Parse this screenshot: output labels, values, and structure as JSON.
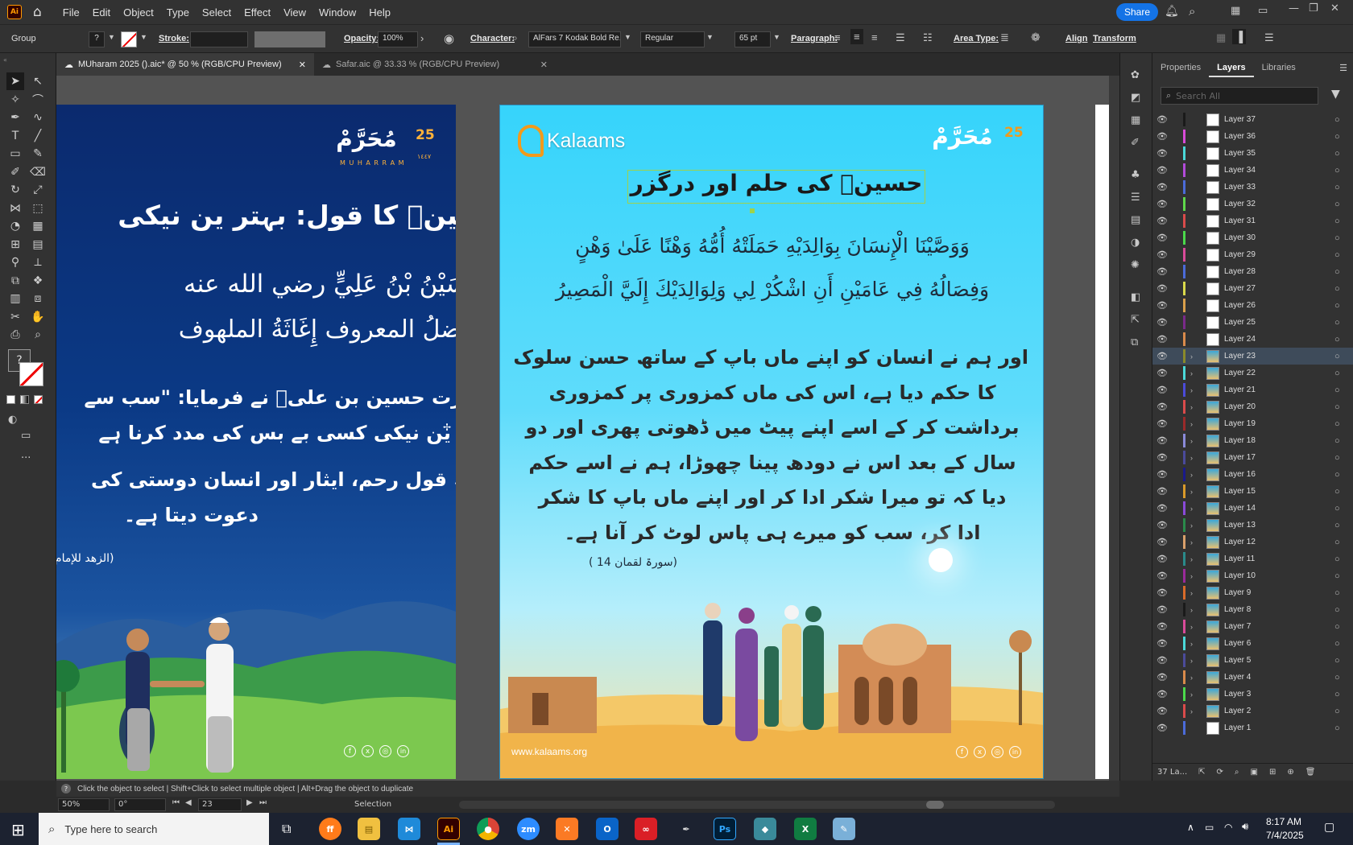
{
  "menubar": {
    "app_logo": "Ai",
    "items": [
      "File",
      "Edit",
      "Object",
      "Type",
      "Select",
      "Effect",
      "View",
      "Window",
      "Help"
    ],
    "share_label": "Share"
  },
  "control_bar": {
    "group_label": "Group",
    "stroke_label": "Stroke:",
    "opacity_label": "Opacity:",
    "opacity_value": "100%",
    "character_label": "Character:",
    "font_family": "AlFars 7 Kodak Bold Re...",
    "font_style": "Regular",
    "font_size": "65 pt",
    "paragraph_label": "Paragraph:",
    "area_type_label": "Area Type:",
    "align_label": "Align",
    "transform_label": "Transform"
  },
  "tabs": [
    {
      "label": "MUharam 2025 ().aic* @ 50 % (RGB/CPU Preview)",
      "active": true
    },
    {
      "label": "Safar.aic @ 33.33 % (RGB/CPU Preview)",
      "active": false
    }
  ],
  "artboard_left": {
    "logo_text": "مُحَرَّمْ",
    "logo_number": "25",
    "logo_sub": "M U H A R R A M",
    "logo_year": "١٤٤٧",
    "title": "حسینؓ کا قول: بہتر ین نیکی",
    "arabic_line1": "قَالَ الْحُسَيْنُ بْنُ عَلِيٍّ رضي الله عنه",
    "arabic_line2": "أَفضلُ المعروف إِغَاثَةُ الملهوف",
    "urdu_line1": "حضرت حسین بن علیؓ نے فرمایا: \"سب سے",
    "urdu_line2": "بہتر ین نیکی کسی بے بس کی مدد کرنا ہے",
    "faida_line1": "فائدہ: یہ قول رحم، ایثار اور انسان دوستی کی",
    "faida_line2": "دعوت دیتا ہے۔",
    "source": "(الزهد للإمام أحمد)"
  },
  "artboard_right": {
    "brand": "Kalaams",
    "logo_text": "مُحَرَّمْ",
    "logo_number": "25",
    "title": "حسینؓ کی حلم اور درگزر",
    "ayah_line1": "وَوَصَّيْنَا الْإِنسَانَ بِوَالِدَيْهِ حَمَلَتْهُ أُمُّهُ وَهْنًا عَلَىٰ وَهْنٍ",
    "ayah_line2": "وَفِصَالُهُ فِي عَامَيْنِ أَنِ اشْكُرْ لِي وَلِوَالِدَيْكَ إِلَيَّ الْمَصِيرُ",
    "urdu_lines": [
      "اور ہم نے انسان کو اپنے ماں باپ کے ساتھ حسن سلوک",
      "کا حکم دیا ہے، اس کی ماں کمزوری پر کمزوری",
      "برداشت کر کے اسے اپنے پیٹ میں ڈھوتی پھری اور دو",
      "سال کے بعد اس نے دودھ پینا چھوڑا، ہم نے اسے حکم",
      "دیا کہ تو میرا شکر ادا کر اور اپنے ماں باپ کا شکر",
      "ادا کر، سب کو میرے ہی پاس لوٹ کر آنا ہے۔"
    ],
    "reference": "(سورۃ لقمان 14 )",
    "website": "www.kalaams.org",
    "social": [
      "f",
      "x",
      "◎",
      "in"
    ]
  },
  "right_panel": {
    "tabs": [
      "Properties",
      "Layers",
      "Libraries"
    ],
    "active_tab": "Layers",
    "search_placeholder": "Search All",
    "layers": [
      {
        "name": "Layer 37",
        "color": "#1a1a1a",
        "thumb": "white"
      },
      {
        "name": "Layer 36",
        "color": "#d94bd9",
        "thumb": "white"
      },
      {
        "name": "Layer 35",
        "color": "#4ad9d9",
        "thumb": "white"
      },
      {
        "name": "Layer 34",
        "color": "#b24bd9",
        "thumb": "white"
      },
      {
        "name": "Layer 33",
        "color": "#4b6bd9",
        "thumb": "white"
      },
      {
        "name": "Layer 32",
        "color": "#5fd94b",
        "thumb": "white"
      },
      {
        "name": "Layer 31",
        "color": "#d94b4b",
        "thumb": "white"
      },
      {
        "name": "Layer 30",
        "color": "#4bd94b",
        "thumb": "white"
      },
      {
        "name": "Layer 29",
        "color": "#d94b9a",
        "thumb": "white"
      },
      {
        "name": "Layer 28",
        "color": "#4b6bd9",
        "thumb": "white"
      },
      {
        "name": "Layer 27",
        "color": "#d9d94b",
        "thumb": "white"
      },
      {
        "name": "Layer 26",
        "color": "#d9a04b",
        "thumb": "white"
      },
      {
        "name": "Layer 25",
        "color": "#7a2a8a",
        "thumb": "white"
      },
      {
        "name": "Layer 24",
        "color": "#d98a4b",
        "thumb": "white"
      },
      {
        "name": "Layer 23",
        "color": "#8a8a2a",
        "thumb": "art"
      },
      {
        "name": "Layer 22",
        "color": "#4bd9d9",
        "thumb": "art"
      },
      {
        "name": "Layer 21",
        "color": "#4b4bd9",
        "thumb": "art"
      },
      {
        "name": "Layer 20",
        "color": "#d94b4b",
        "thumb": "art"
      },
      {
        "name": "Layer 19",
        "color": "#9a2a2a",
        "thumb": "art"
      },
      {
        "name": "Layer 18",
        "color": "#8a8ad9",
        "thumb": "art"
      },
      {
        "name": "Layer 17",
        "color": "#4a4a9a",
        "thumb": "art"
      },
      {
        "name": "Layer 16",
        "color": "#1a1a8a",
        "thumb": "art"
      },
      {
        "name": "Layer 15",
        "color": "#d99a2a",
        "thumb": "art"
      },
      {
        "name": "Layer 14",
        "color": "#8a4ad9",
        "thumb": "art"
      },
      {
        "name": "Layer 13",
        "color": "#2a8a4a",
        "thumb": "art"
      },
      {
        "name": "Layer 12",
        "color": "#d9a06b",
        "thumb": "art"
      },
      {
        "name": "Layer 11",
        "color": "#2a8a8a",
        "thumb": "art"
      },
      {
        "name": "Layer 10",
        "color": "#9a2a9a",
        "thumb": "art"
      },
      {
        "name": "Layer 9",
        "color": "#d96b2a",
        "thumb": "art"
      },
      {
        "name": "Layer 8",
        "color": "#1a1a1a",
        "thumb": "art"
      },
      {
        "name": "Layer 7",
        "color": "#d94b9a",
        "thumb": "art"
      },
      {
        "name": "Layer 6",
        "color": "#4bd9d9",
        "thumb": "art"
      },
      {
        "name": "Layer 5",
        "color": "#4b4b9a",
        "thumb": "art"
      },
      {
        "name": "Layer 4",
        "color": "#d98a4b",
        "thumb": "art"
      },
      {
        "name": "Layer 3",
        "color": "#4bd94b",
        "thumb": "art"
      },
      {
        "name": "Layer 2",
        "color": "#d94b4b",
        "thumb": "art"
      },
      {
        "name": "Layer 1",
        "color": "#4b6bd9",
        "thumb": "white"
      }
    ],
    "footer_count": "37 La..."
  },
  "status_bar": {
    "hint": "Click the object to select  |  Shift+Click to select multiple object  |  Alt+Drag the object to duplicate"
  },
  "info_bar": {
    "zoom": "50%",
    "rotation": "0°",
    "artboard_num": "23",
    "tool": "Selection"
  },
  "taskbar": {
    "search_placeholder": "Type here to search",
    "time": "8:17 AM",
    "date": "7/4/2025"
  }
}
